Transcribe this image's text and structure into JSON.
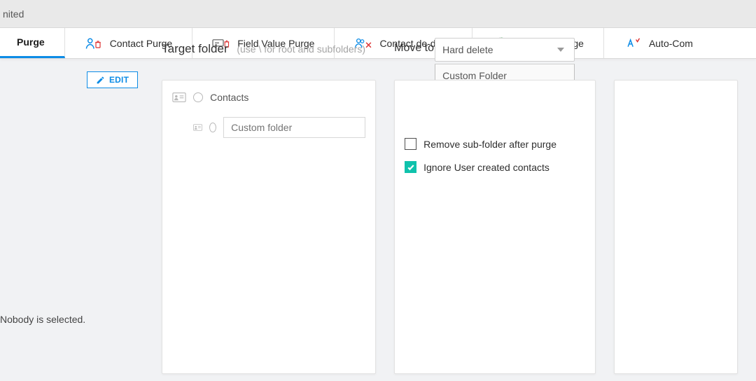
{
  "top": {
    "title_fragment": "nited"
  },
  "tabs": [
    {
      "label": "Purge",
      "icon": "none"
    },
    {
      "label": "Contact Purge",
      "icon": "contact-purge"
    },
    {
      "label": "Field Value Purge",
      "icon": "field-value-purge"
    },
    {
      "label": "Contact de-dupe",
      "icon": "contact-dedupe"
    },
    {
      "label": "Add2Exchange",
      "icon": "add2exchange"
    },
    {
      "label": "Auto-Com",
      "icon": "auto-complete"
    }
  ],
  "left": {
    "edit_label": "EDIT",
    "nobody": "Nobody is selected."
  },
  "target": {
    "title": "Target folder",
    "hint": "(use \\ for root and subfolders)",
    "root_label": "Contacts",
    "custom_placeholder": "Custom folder"
  },
  "move": {
    "label": "Move to",
    "selected": "Hard delete",
    "option": "Custom Folder",
    "cb_remove": "Remove sub-folder after purge",
    "cb_ignore": "Ignore User created contacts",
    "remove_checked": false,
    "ignore_checked": true
  }
}
